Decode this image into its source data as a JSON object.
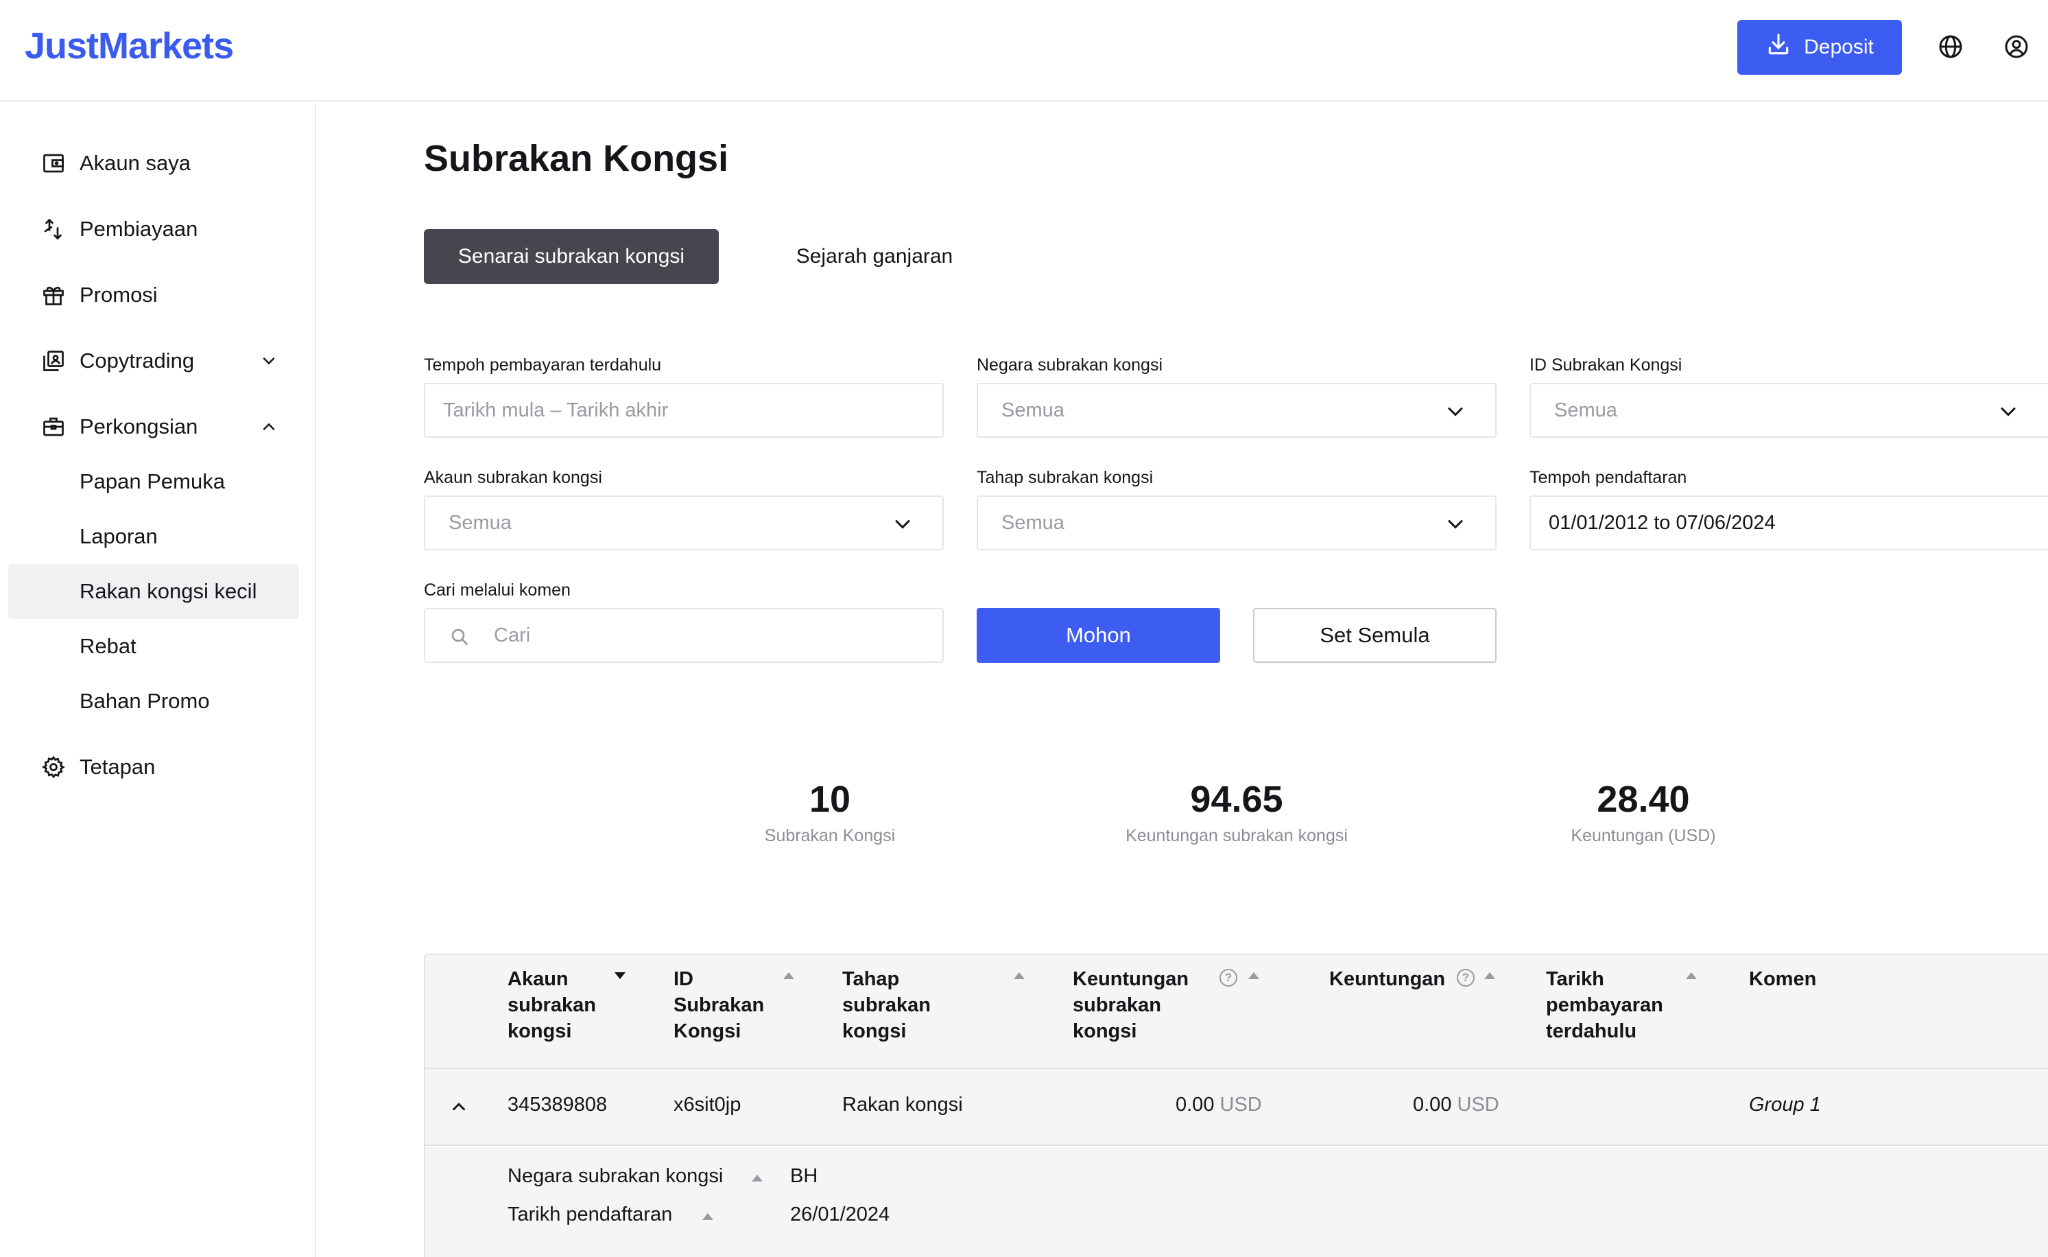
{
  "header": {
    "logo": "JustMarkets",
    "deposit_label": "Deposit"
  },
  "sidebar": {
    "items": [
      {
        "label": "Akaun saya",
        "icon": "wallet-icon"
      },
      {
        "label": "Pembiayaan",
        "icon": "transfer-icon"
      },
      {
        "label": "Promosi",
        "icon": "gift-icon"
      },
      {
        "label": "Copytrading",
        "icon": "copytrading-icon"
      },
      {
        "label": "Perkongsian",
        "icon": "briefcase-icon"
      },
      {
        "label": "Tetapan",
        "icon": "gear-icon"
      }
    ],
    "sub_items": [
      {
        "label": "Papan Pemuka"
      },
      {
        "label": "Laporan"
      },
      {
        "label": "Rakan kongsi kecil"
      },
      {
        "label": "Rebat"
      },
      {
        "label": "Bahan Promo"
      }
    ]
  },
  "main": {
    "title": "Subrakan Kongsi",
    "tabs": [
      {
        "label": "Senarai subrakan kongsi"
      },
      {
        "label": "Sejarah ganjaran"
      }
    ],
    "filters": {
      "last_payment_period": {
        "label": "Tempoh pembayaran terdahulu",
        "placeholder": "Tarikh mula – Tarikh akhir"
      },
      "country": {
        "label": "Negara subrakan kongsi",
        "value": "Semua"
      },
      "id": {
        "label": "ID Subrakan Kongsi",
        "value": "Semua"
      },
      "account": {
        "label": "Akaun subrakan kongsi",
        "value": "Semua"
      },
      "level": {
        "label": "Tahap subrakan kongsi",
        "value": "Semua"
      },
      "registration_period": {
        "label": "Tempoh pendaftaran",
        "value": "01/01/2012 to 07/06/2024"
      },
      "comment_search": {
        "label": "Cari melalui komen",
        "placeholder": "Cari"
      }
    },
    "apply_label": "Mohon",
    "reset_label": "Set Semula"
  },
  "stats": [
    {
      "value": "10",
      "label": "Subrakan Kongsi"
    },
    {
      "value": "94.65",
      "label": "Keuntungan subrakan kongsi"
    },
    {
      "value": "28.40",
      "label": "Keuntungan (USD)"
    }
  ],
  "table": {
    "headers": {
      "account": [
        "Akaun",
        "subrakan",
        "kongsi"
      ],
      "id": [
        "ID",
        "Subrakan",
        "Kongsi"
      ],
      "level": [
        "Tahap",
        "subrakan",
        "kongsi"
      ],
      "subpartner_profit": [
        "Keuntungan",
        "subrakan",
        "kongsi"
      ],
      "profit": "Keuntungan",
      "last_payment": [
        "Tarikh",
        "pembayaran",
        "terdahulu"
      ],
      "comment": "Komen"
    },
    "help_glyph": "?",
    "rows": [
      {
        "account": "345389808",
        "id": "x6sit0jp",
        "level": "Rakan kongsi",
        "subpartner_profit": "0.00",
        "subpartner_profit_unit": "USD",
        "profit": "0.00",
        "profit_unit": "USD",
        "last_payment": "",
        "comment": "Group 1",
        "details": {
          "country_label": "Negara subrakan kongsi",
          "country_value": "BH",
          "registration_label": "Tarikh pendaftaran",
          "registration_value": "26/01/2024"
        }
      }
    ]
  },
  "colors": {
    "brand": "#3a5bf0",
    "primary_button": "#3c5cf2",
    "active_tab": "#46464f"
  }
}
